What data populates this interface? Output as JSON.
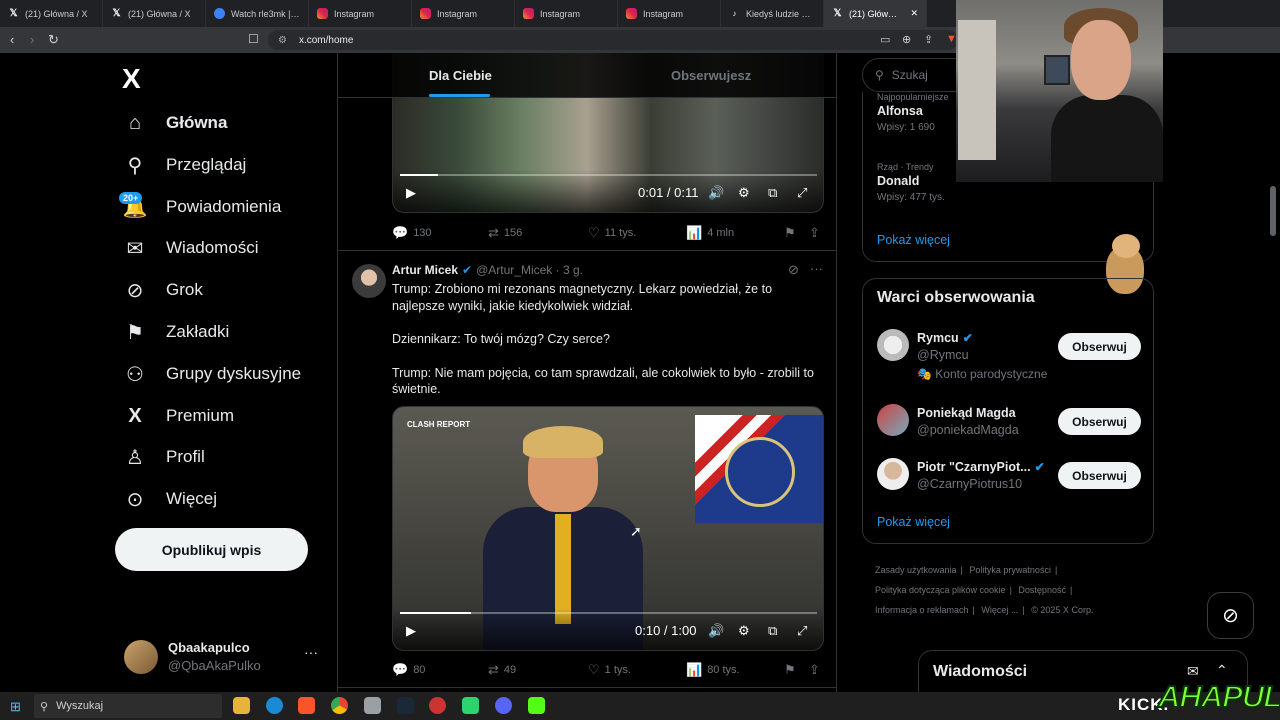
{
  "browser": {
    "tabs": [
      {
        "title": "(21) Główna / X",
        "icon": "x"
      },
      {
        "title": "(21) Główna / X",
        "icon": "x"
      },
      {
        "title": "Watch rle3mk | Stre",
        "icon": "streamable"
      },
      {
        "title": "Instagram",
        "icon": "instagram"
      },
      {
        "title": "Instagram",
        "icon": "instagram"
      },
      {
        "title": "Instagram",
        "icon": "instagram"
      },
      {
        "title": "Instagram",
        "icon": "instagram"
      },
      {
        "title": "Kiedyś ludzie mieli",
        "icon": "tiktok"
      },
      {
        "title": "(21) Główna / X",
        "icon": "x",
        "active": true
      }
    ],
    "url": "x.com/home"
  },
  "nav": {
    "logo": "X",
    "items": [
      {
        "label": "Główna",
        "icon": "home-icon",
        "glyph": "⌂",
        "active": true
      },
      {
        "label": "Przeglądaj",
        "icon": "search-icon",
        "glyph": "⚲"
      },
      {
        "label": "Powiadomienia",
        "icon": "bell-icon",
        "glyph": "🔔"
      },
      {
        "label": "Wiadomości",
        "icon": "mail-icon",
        "glyph": "✉"
      },
      {
        "label": "Grok",
        "icon": "grok-icon",
        "glyph": "⊘"
      },
      {
        "label": "Zakładki",
        "icon": "bookmark-icon",
        "glyph": "🔖"
      },
      {
        "label": "Grupy dyskusyjne",
        "icon": "communities-icon",
        "glyph": "👥"
      },
      {
        "label": "Premium",
        "icon": "x-premium-icon",
        "glyph": "X"
      },
      {
        "label": "Profil",
        "icon": "person-icon",
        "glyph": "👤"
      },
      {
        "label": "Więcej",
        "icon": "more-circle-icon",
        "glyph": "⋯"
      }
    ],
    "notifications_badge": "20+",
    "post_button": "Opublikuj wpis",
    "account": {
      "name": "Qbaakapulco",
      "handle": "@QbaAkaPulko",
      "more": "···"
    }
  },
  "feed": {
    "tabs": {
      "for_you": "Dla Ciebie",
      "following": "Obserwujesz"
    },
    "tweet1": {
      "video": {
        "time": "0:01 / 0:11",
        "progress": 0.09
      },
      "stats": {
        "replies": "130",
        "reposts": "156",
        "likes": "11 tys.",
        "views": "4 mln"
      }
    },
    "tweet2": {
      "name": "Artur Micek",
      "handle": "@Artur_Micek",
      "time": "3 g.",
      "paragraphs": [
        "Trump: Zrobiono mi rezonans magnetyczny. Lekarz powiedział, że to najlepsze wyniki, jakie kiedykolwiek widział.",
        "Dziennikarz: To twój mózg? Czy serce?",
        "Trump: Nie mam pojęcia, co tam sprawdzali, ale cokolwiek to było - zrobili to świetnie."
      ],
      "video": {
        "time": "0:10 / 1:00",
        "progress": 0.17,
        "brand": "CLASH REPORT"
      },
      "stats": {
        "replies": "80",
        "reposts": "49",
        "likes": "1 tys.",
        "views": "80 tys."
      }
    }
  },
  "sidebar": {
    "search_placeholder": "Szukaj",
    "trends": [
      {
        "context": "Najpopularniejsze",
        "name": "Alfonsa",
        "count": "Wpisy: 1 690"
      },
      {
        "context": "Rząd · Trendy",
        "name": "Donald",
        "count": "Wpisy: 477 tys."
      }
    ],
    "show_more": "Pokaż więcej",
    "who_to_follow": {
      "title": "Warci obserwowania",
      "suggestions": [
        {
          "name": "Rymcu",
          "handle": "@Rymcu",
          "verified": true,
          "sub": "Konto parodystyczne",
          "button": "Obserwuj"
        },
        {
          "name": "Poniekąd Magda",
          "handle": "@poniekadMagda",
          "verified": false,
          "button": "Obserwuj"
        },
        {
          "name": "Piotr \"CzarnyPiot...",
          "handle": "@CzarnyPiotrus10",
          "verified": true,
          "button": "Obserwuj"
        }
      ],
      "show_more": "Pokaż więcej"
    },
    "footer": [
      "Zasady użytkowania",
      "|",
      "Polityka prywatności",
      "|",
      "Polityka dotycząca plików cookie",
      "|",
      "Dostępność",
      "|",
      "Informacja o reklamach",
      "|",
      "Więcej ...",
      "|",
      "© 2025 X Corp."
    ],
    "messages": "Wiadomości"
  },
  "taskbar": {
    "search": "Wyszukaj"
  },
  "overlay": {
    "kick": "KICK.",
    "brand": "AHAPULCO"
  },
  "colors": {
    "accent": "#1d9bf0",
    "background": "#000000",
    "border": "#2f3336",
    "muted": "#71767b"
  }
}
